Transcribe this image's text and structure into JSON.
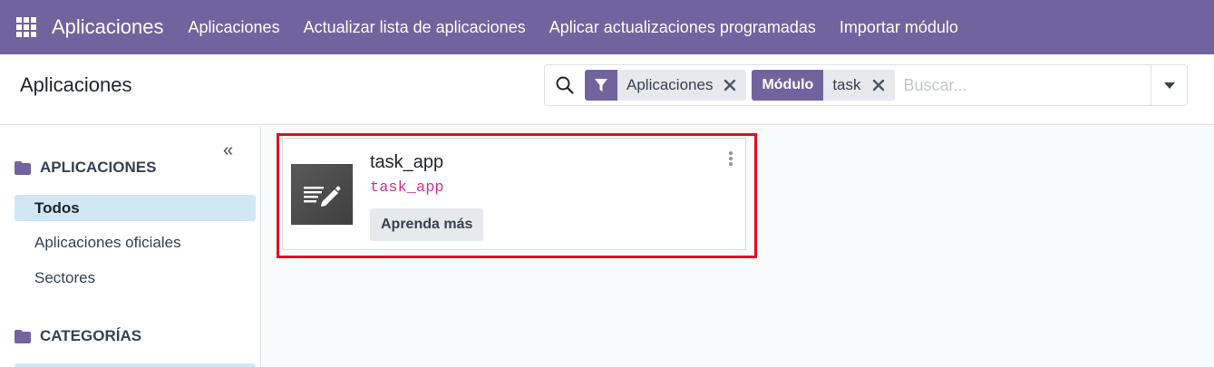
{
  "navbar": {
    "app_name": "Aplicaciones",
    "menu": [
      "Aplicaciones",
      "Actualizar lista de aplicaciones",
      "Aplicar actualizaciones programadas",
      "Importar módulo"
    ],
    "color": "#71639e"
  },
  "control_panel": {
    "title": "Aplicaciones",
    "search": {
      "placeholder": "Buscar...",
      "facets": [
        {
          "type": "filter",
          "icon": "filter-icon",
          "value": "Aplicaciones"
        },
        {
          "type": "field",
          "label": "Módulo",
          "value": "task"
        }
      ]
    }
  },
  "sidepanel": {
    "collapse_icon": "«",
    "sections": [
      {
        "title": "APLICACIONES",
        "icon": "folder-icon",
        "items": [
          "Todos",
          "Aplicaciones oficiales",
          "Sectores"
        ],
        "active": "Todos"
      },
      {
        "title": "CATEGORÍAS",
        "icon": "folder-icon",
        "items": []
      }
    ]
  },
  "kanban": {
    "cards": [
      {
        "name": "task_app",
        "technical_name": "task_app",
        "button": "Aprenda más",
        "icon": "edit-document-icon"
      }
    ],
    "highlight_color": "#e3101d"
  }
}
